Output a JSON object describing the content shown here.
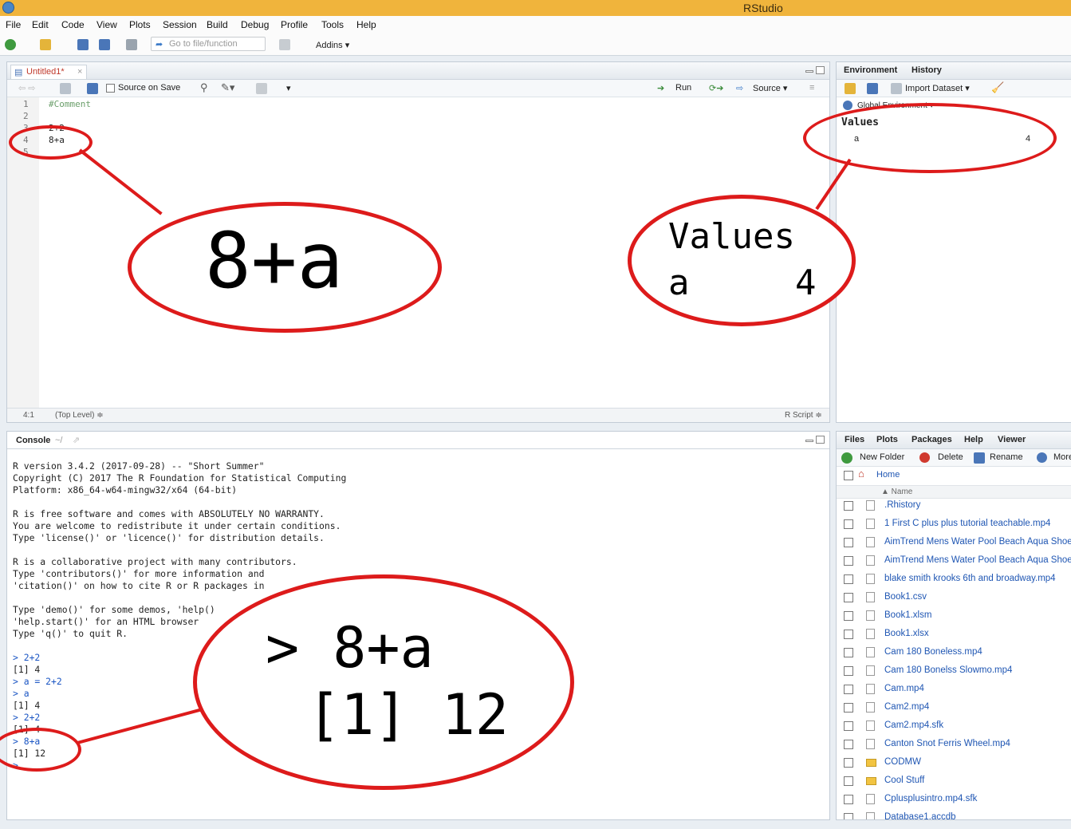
{
  "app": {
    "title": "RStudio"
  },
  "menu": [
    "File",
    "Edit",
    "Code",
    "View",
    "Plots",
    "Session",
    "Build",
    "Debug",
    "Profile",
    "Tools",
    "Help"
  ],
  "toolbar": {
    "goto_placeholder": "Go to file/function",
    "addins_label": "Addins"
  },
  "source": {
    "tab_label": "Untitled1*",
    "source_on_save_label": "Source on Save",
    "run_label": "Run",
    "source_label": "Source",
    "line_numbers": [
      "1",
      "2",
      "3",
      "4",
      "5"
    ],
    "lines": [
      "#Comment",
      "",
      "2+2",
      "8+a",
      ""
    ],
    "cursor_position": "4:1",
    "scope": "(Top Level) ≑",
    "file_type": "R Script ≑"
  },
  "environment": {
    "tabs": [
      "Environment",
      "History"
    ],
    "import_label": "Import Dataset",
    "scope_label": "Global Environment",
    "section": "Values",
    "var_name": "a",
    "var_value": "4"
  },
  "console": {
    "title": "Console",
    "path": "~/",
    "lines": [
      {
        "text": "R version 3.4.2 (2017-09-28) -- \"Short Summer\"",
        "kind": "out"
      },
      {
        "text": "Copyright (C) 2017 The R Foundation for Statistical Computing",
        "kind": "out"
      },
      {
        "text": "Platform: x86_64-w64-mingw32/x64 (64-bit)",
        "kind": "out"
      },
      {
        "text": "",
        "kind": "out"
      },
      {
        "text": "R is free software and comes with ABSOLUTELY NO WARRANTY.",
        "kind": "out"
      },
      {
        "text": "You are welcome to redistribute it under certain conditions.",
        "kind": "out"
      },
      {
        "text": "Type 'license()' or 'licence()' for distribution details.",
        "kind": "out"
      },
      {
        "text": "",
        "kind": "out"
      },
      {
        "text": "R is a collaborative project with many contributors.",
        "kind": "out"
      },
      {
        "text": "Type 'contributors()' for more information and",
        "kind": "out"
      },
      {
        "text": "'citation()' on how to cite R or R packages in",
        "kind": "out"
      },
      {
        "text": "",
        "kind": "out"
      },
      {
        "text": "Type 'demo()' for some demos, 'help()",
        "kind": "out"
      },
      {
        "text": "'help.start()' for an HTML browser",
        "kind": "out"
      },
      {
        "text": "Type 'q()' to quit R.",
        "kind": "out"
      },
      {
        "text": "",
        "kind": "out"
      },
      {
        "text": "> 2+2",
        "kind": "in"
      },
      {
        "text": "[1] 4",
        "kind": "out"
      },
      {
        "text": "> a = 2+2",
        "kind": "in"
      },
      {
        "text": "> a",
        "kind": "in"
      },
      {
        "text": "[1] 4",
        "kind": "out"
      },
      {
        "text": "> 2+2",
        "kind": "in"
      },
      {
        "text": "[1] 4",
        "kind": "out"
      },
      {
        "text": "> 8+a",
        "kind": "in"
      },
      {
        "text": "[1] 12",
        "kind": "out"
      },
      {
        "text": ">",
        "kind": "in"
      }
    ]
  },
  "files": {
    "tabs": [
      "Files",
      "Plots",
      "Packages",
      "Help",
      "Viewer"
    ],
    "new_folder_label": "New Folder",
    "delete_label": "Delete",
    "rename_label": "Rename",
    "more_label": "More",
    "breadcrumb": "Home",
    "column_name": "▲ Name",
    "items": [
      {
        "name": ".Rhistory",
        "folder": false
      },
      {
        "name": "1 First C plus plus tutorial teachable.mp4",
        "folder": false
      },
      {
        "name": "AimTrend Mens Water Pool Beach Aqua Shoe",
        "folder": false
      },
      {
        "name": "AimTrend Mens Water Pool Beach Aqua Shoe",
        "folder": false
      },
      {
        "name": "blake smith krooks 6th and broadway.mp4",
        "folder": false
      },
      {
        "name": "Book1.csv",
        "folder": false
      },
      {
        "name": "Book1.xlsm",
        "folder": false
      },
      {
        "name": "Book1.xlsx",
        "folder": false
      },
      {
        "name": "Cam 180 Boneless.mp4",
        "folder": false
      },
      {
        "name": "Cam 180 Bonelss Slowmo.mp4",
        "folder": false
      },
      {
        "name": "Cam.mp4",
        "folder": false
      },
      {
        "name": "Cam2.mp4",
        "folder": false
      },
      {
        "name": "Cam2.mp4.sfk",
        "folder": false
      },
      {
        "name": "Canton Snot Ferris Wheel.mp4",
        "folder": false
      },
      {
        "name": "CODMW",
        "folder": true
      },
      {
        "name": "Cool Stuff",
        "folder": true
      },
      {
        "name": "Cplusplusintro.mp4.sfk",
        "folder": false
      },
      {
        "name": "Database1.accdb",
        "folder": false
      }
    ]
  },
  "annotations": {
    "editor_callout": "8+a",
    "env_callout_line1": "Values",
    "env_callout_line2": "a     4",
    "console_callout_line1": "> 8+a",
    "console_callout_line2": "[1] 12"
  }
}
